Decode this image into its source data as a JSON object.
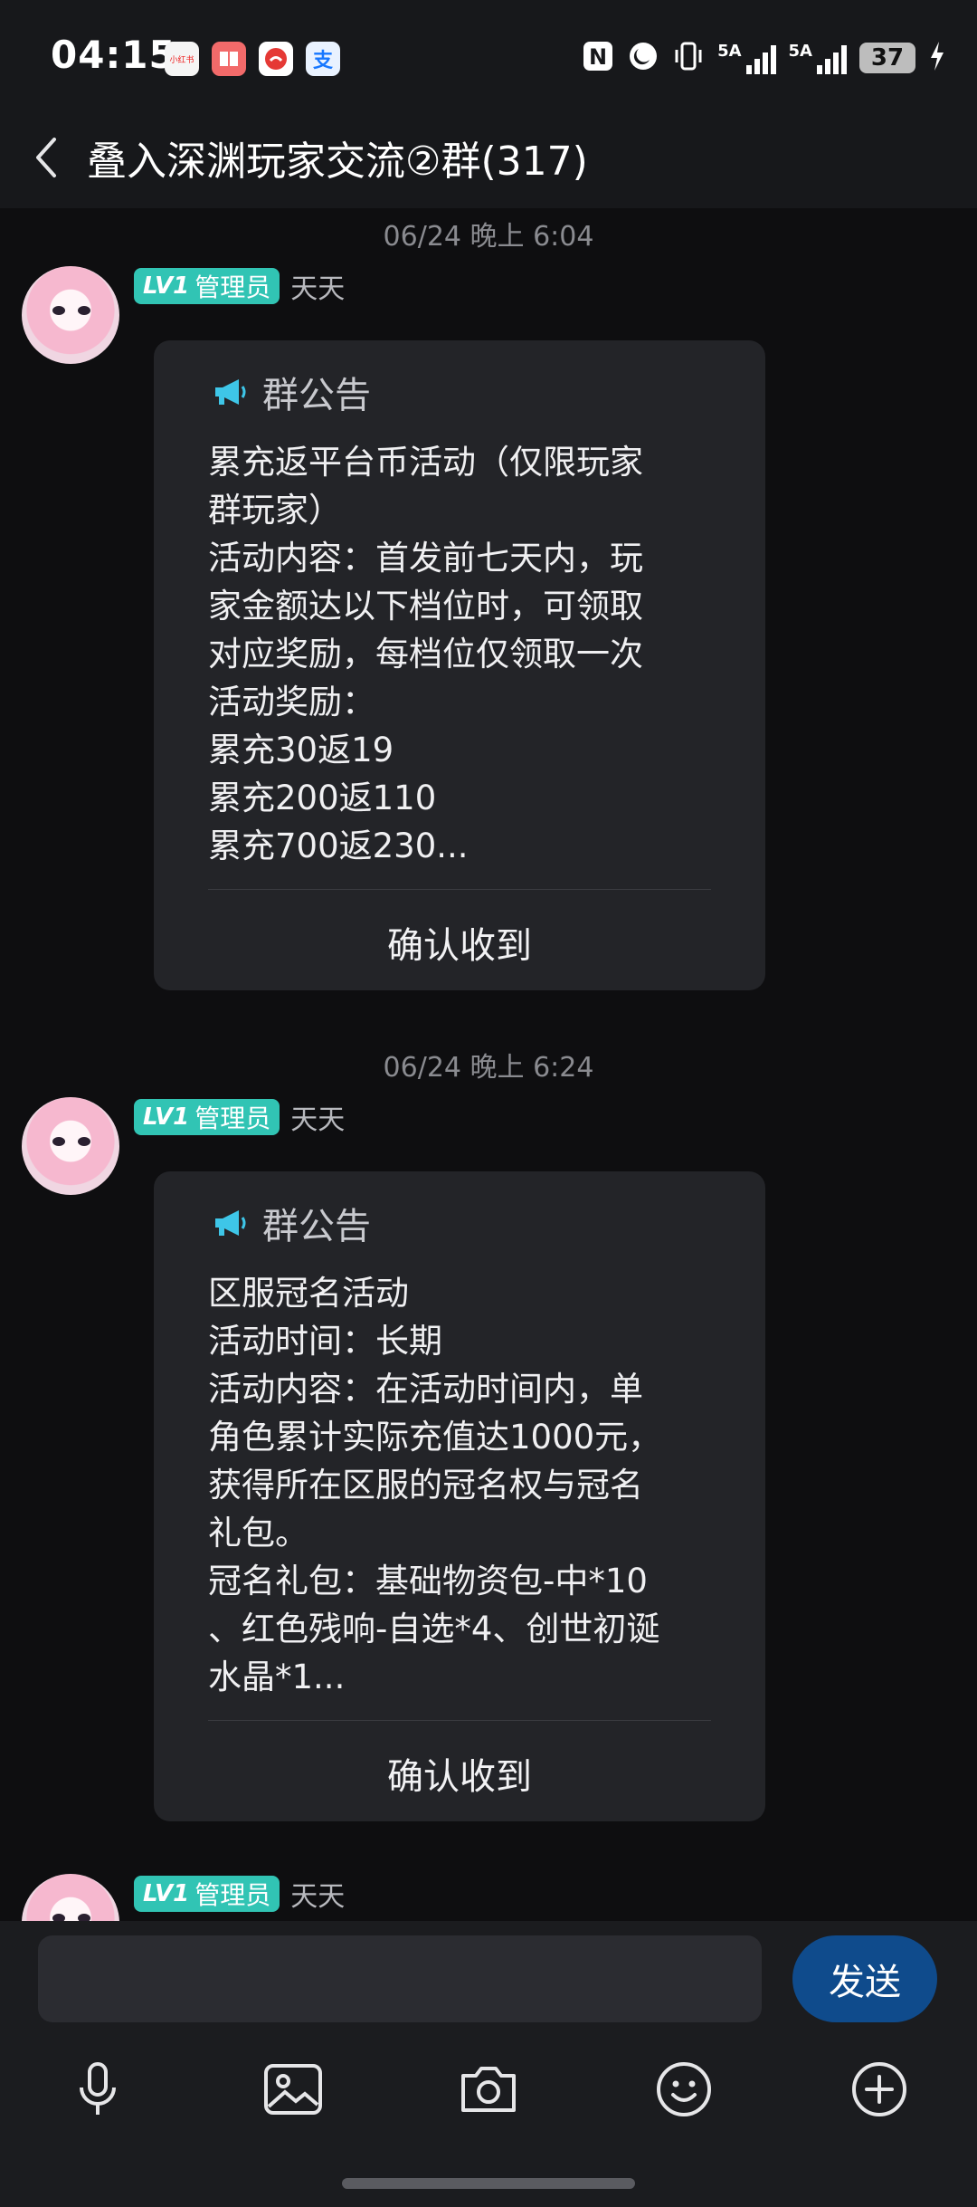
{
  "status_bar": {
    "time": "04:15",
    "app_icons": [
      "小红书",
      "books",
      "phone",
      "alipay"
    ],
    "signal_label_1": "5A",
    "signal_label_2": "5A",
    "battery": "37"
  },
  "header": {
    "title": "叠入深渊玩家交流②群(317)"
  },
  "messages": [
    {
      "timestamp": "06/24 晚上 6:04",
      "badge_level": "LV1",
      "badge_role": "管理员",
      "sender": "天天",
      "card_label": "群公告",
      "body": "累充返平台币活动（仅限玩家\n群玩家）\n活动内容：首发前七天内，玩\n家金额达以下档位时，可领取\n对应奖励，每档位仅领取一次\n活动奖励：\n累充30返19\n累充200返110\n累充700返230...",
      "confirm": "确认收到"
    },
    {
      "timestamp": "06/24 晚上 6:24",
      "badge_level": "LV1",
      "badge_role": "管理员",
      "sender": "天天",
      "card_label": "群公告",
      "body": "区服冠名活动\n活动时间：长期\n活动内容：在活动时间内，单\n角色累计实际充值达1000元，\n获得所在区服的冠名权与冠名\n礼包。\n冠名礼包：基础物资包-中*10\n、红色残响-自选*4、创世初诞\n水晶*1...",
      "confirm": "确认收到"
    },
    {
      "badge_level": "LV1",
      "badge_role": "管理员",
      "sender": "天天"
    }
  ],
  "input": {
    "placeholder": "",
    "send_label": "发送"
  },
  "toolbar": [
    "microphone-icon",
    "image-icon",
    "camera-icon",
    "emoji-icon",
    "plus-icon"
  ],
  "colors": {
    "background": "#0e0e10",
    "card": "#232428",
    "badge": "#31c4b4",
    "send_button": "#0f4b8c",
    "announcement_icon": "#3ec6e8"
  }
}
